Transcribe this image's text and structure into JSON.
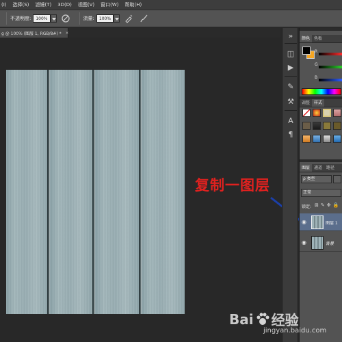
{
  "menu": {
    "items": [
      "(I)",
      "选择(S)",
      "滤镜(T)",
      "3D(D)",
      "视图(V)",
      "窗口(W)",
      "帮助(H)"
    ]
  },
  "options": {
    "opacity_label": "不透明度:",
    "opacity_value": "100%",
    "flow_label": "流量:",
    "flow_value": "100%"
  },
  "document": {
    "tab_title": "g @ 100% (图层 1, RGB/8#) *",
    "close": "×"
  },
  "panels": {
    "color_tabs": [
      "颜色",
      "色板"
    ],
    "channels": [
      "R",
      "G",
      "B"
    ],
    "channel_colors": [
      "#ff2b2b",
      "#2bd12b",
      "#2b5bff"
    ],
    "styles_tabs": [
      "调整",
      "样式"
    ],
    "layers_tabs": [
      "图层",
      "通道",
      "路径"
    ],
    "kind_filter": "ρ 类型",
    "blend_mode": "正常",
    "lock_label": "锁定:",
    "layers": [
      {
        "name": "图层 1",
        "selected": true
      },
      {
        "name": "背景",
        "selected": false
      }
    ]
  },
  "annotation": {
    "text": "复制一图层",
    "color": "#e0211f"
  },
  "watermark": {
    "left": "Bai",
    "right": "经验",
    "url": "jingyan.baidu.com"
  },
  "icons": {
    "brush": "brush-icon",
    "airbrush": "airbrush-icon",
    "pressure": "pressure-icon",
    "eye": "eye-icon"
  }
}
